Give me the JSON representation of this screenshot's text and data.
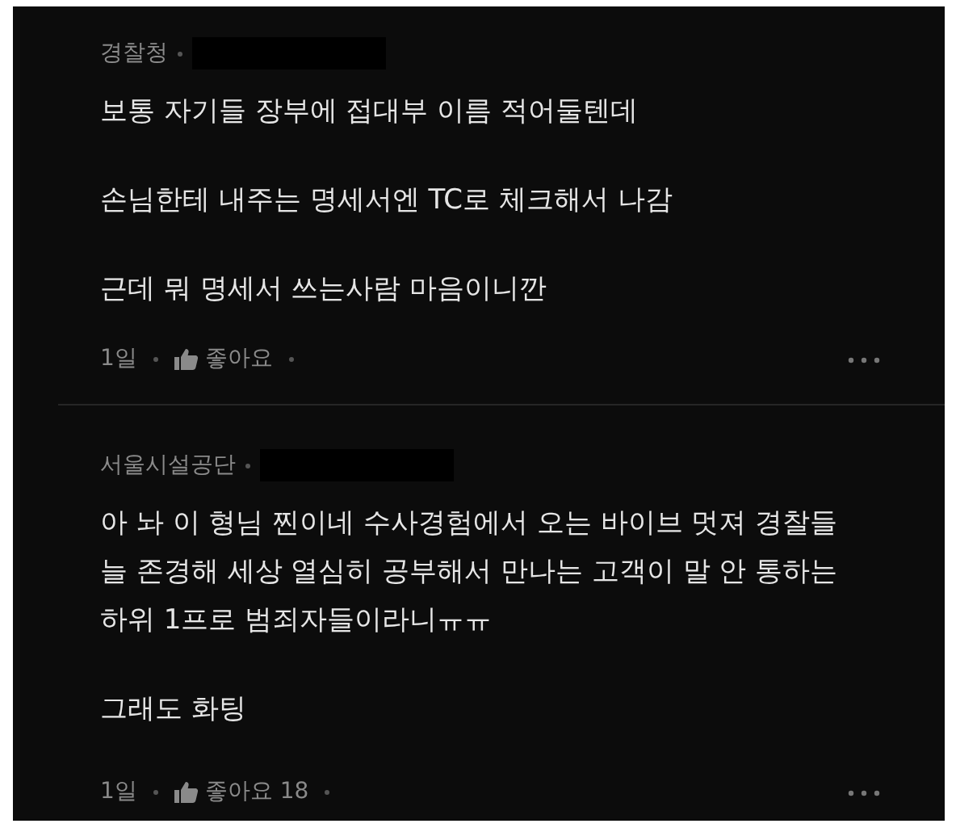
{
  "comments": [
    {
      "company": "경찰청",
      "nickname_hidden": true,
      "paragraphs": [
        "보통 자기들 장부에 접대부 이름 적어둘텐데",
        "손님한테 내주는 명세서엔 TC로 체크해서 나감",
        "근데 뭐 명세서 쓰는사람 마음이니깐"
      ],
      "time": "1일",
      "like_label": "좋아요"
    },
    {
      "company": "서울시설공단",
      "nickname_hidden": true,
      "paragraphs": [
        "아 놔 이 형님 찐이네 수사경험에서 오는 바이브 멋져 경찰들 늘 존경해 세상 열심히 공부해서 만나는 고객이 말 안 통하는 하위 1프로 범죄자들이라니ㅠㅠ",
        "그래도 화팅"
      ],
      "time": "1일",
      "like_label": "좋아요 18"
    }
  ]
}
